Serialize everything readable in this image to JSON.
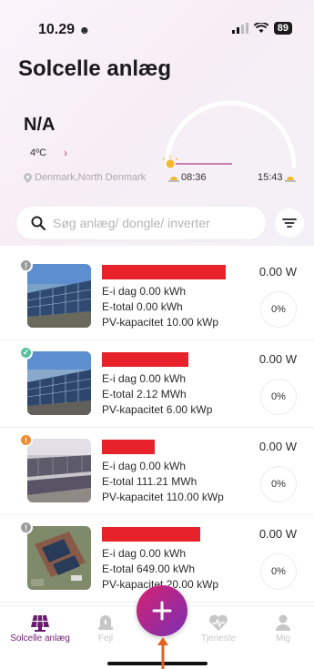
{
  "status_bar": {
    "time": "10.29",
    "battery": "89"
  },
  "header": {
    "title": "Solcelle anlæg"
  },
  "weather": {
    "condition": "N/A",
    "temperature": "4ºC",
    "location": "Denmark,North Denmark",
    "sunrise": "08:36",
    "sunset": "15:43"
  },
  "search": {
    "placeholder": "Søg anlæg/ dongle/ inverter"
  },
  "plants": [
    {
      "status": "offline",
      "status_color": "#9b9b9b",
      "today": "E-i dag 0.00 kWh",
      "total": "E-total 0.00 kWh",
      "capacity": "PV-kapacitet 10.00 kWp",
      "power": "0.00 W",
      "percent": "0%"
    },
    {
      "status": "normal",
      "status_color": "#56c2a0",
      "today": "E-i dag 0.00 kWh",
      "total": "E-total 2.12 MWh",
      "capacity": "PV-kapacitet 6.00 kWp",
      "power": "0.00 W",
      "percent": "0%"
    },
    {
      "status": "warning",
      "status_color": "#f08a2c",
      "today": "E-i dag 0.00 kWh",
      "total": "E-total 111.21 MWh",
      "capacity": "PV-kapacitet 110.00 kWp",
      "power": "0.00 W",
      "percent": "0%"
    },
    {
      "status": "offline",
      "status_color": "#9b9b9b",
      "today": "E-i dag 0.00 kWh",
      "total": "E-total 649.00 kWh",
      "capacity": "PV-kapacitet 20.00 kWp",
      "power": "0.00 W",
      "percent": "0%"
    }
  ],
  "nav": {
    "items": [
      {
        "label": "Solcelle anlæg",
        "icon": "solar-panel-icon"
      },
      {
        "label": "Fejl",
        "icon": "alarm-bell-icon"
      },
      {
        "label": "Tjeneste",
        "icon": "heart-service-icon"
      },
      {
        "label": "Mig",
        "icon": "user-icon"
      }
    ],
    "fab_icon": "plus-icon"
  },
  "colors": {
    "accent": "#6b1e6f",
    "fab_start": "#d6226f",
    "fab_end": "#7a2fb5",
    "redaction": "#e8222a",
    "annotation_arrow": "#e0621e"
  }
}
